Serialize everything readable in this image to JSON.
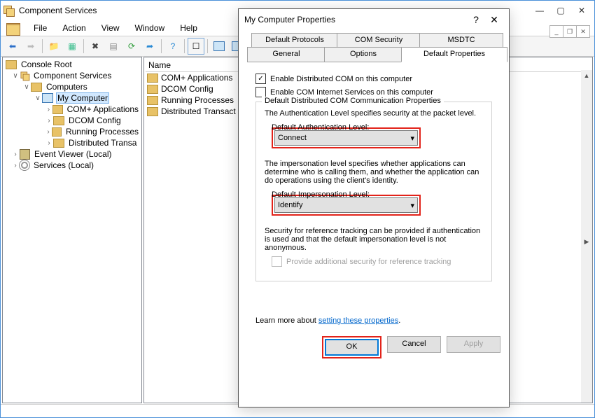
{
  "mmc": {
    "title": "Component Services",
    "menu": [
      "File",
      "Action",
      "View",
      "Window",
      "Help"
    ],
    "col_header": "Name",
    "tree": {
      "root": "Console Root",
      "compsvc": "Component Services",
      "computers": "Computers",
      "mycomp": "My Computer",
      "nodes": [
        "COM+ Applications",
        "DCOM Config",
        "Running Processes",
        "Distributed Transa"
      ],
      "eventviewer": "Event Viewer (Local)",
      "services": "Services (Local)"
    },
    "list": [
      "COM+ Applications",
      "DCOM Config",
      "Running Processes",
      "Distributed Transact"
    ]
  },
  "dlg": {
    "title": "My Computer Properties",
    "tabs_top": [
      "Default Protocols",
      "COM Security",
      "MSDTC"
    ],
    "tabs_bottom": [
      "General",
      "Options",
      "Default Properties"
    ],
    "chk1": "Enable Distributed COM on this computer",
    "chk2": "Enable COM Internet Services on this computer",
    "group1": "Default Distributed COM Communication Properties",
    "t1": "The Authentication Level specifies security at the packet level.",
    "dal_label": "Default Authentication Level:",
    "dal_value": "Connect",
    "t2": "The impersonation level specifies whether applications can determine who is calling them, and whether the application can do operations using the client's identity.",
    "dil_label": "Default Impersonation Level:",
    "dil_value": "Identify",
    "t3": "Security for reference tracking can be provided if authentication is used and that the default impersonation level is not anonymous.",
    "chk3": "Provide additional security for reference tracking",
    "learn": "Learn more about ",
    "learn_link": "setting these properties",
    "btn_ok": "OK",
    "btn_cancel": "Cancel",
    "btn_apply": "Apply"
  }
}
